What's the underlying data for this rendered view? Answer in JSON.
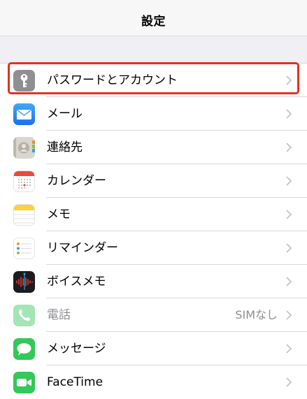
{
  "nav": {
    "title": "設定"
  },
  "rows": [
    {
      "label": "パスワードとアカウント",
      "icon": "key-icon"
    },
    {
      "label": "メール",
      "icon": "mail-icon"
    },
    {
      "label": "連絡先",
      "icon": "contacts-icon"
    },
    {
      "label": "カレンダー",
      "icon": "calendar-icon"
    },
    {
      "label": "メモ",
      "icon": "notes-icon"
    },
    {
      "label": "リマインダー",
      "icon": "reminders-icon"
    },
    {
      "label": "ボイスメモ",
      "icon": "voice-memos-icon"
    },
    {
      "label": "電話",
      "icon": "phone-icon",
      "detail": "SIMなし"
    },
    {
      "label": "メッセージ",
      "icon": "messages-icon"
    },
    {
      "label": "FaceTime",
      "icon": "facetime-icon"
    }
  ],
  "colors": {
    "highlight": "#e5311f",
    "background": "#efeff4",
    "separator": "#d8d8dc",
    "secondary_text": "#8e8e93",
    "mail_blue": "#2f8cf5",
    "green": "#34c759",
    "calendar_red": "#f2453c",
    "notes_yellow": "#f9d13c"
  }
}
